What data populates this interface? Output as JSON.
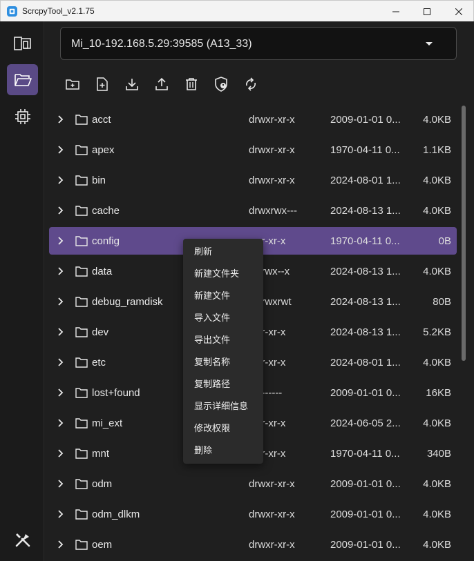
{
  "window": {
    "title": "ScrcpyTool_v2.1.75"
  },
  "colors": {
    "accent": "#5f4a8c",
    "sidebar_active": "#5a4a86",
    "background": "#1f1f1f"
  },
  "sidebar": {
    "items": [
      {
        "icon": "devices-icon",
        "active": false
      },
      {
        "icon": "folder-open-icon",
        "active": true
      },
      {
        "icon": "chip-icon",
        "active": false
      },
      {
        "icon": "tools-icon",
        "active": false
      }
    ]
  },
  "device_select": {
    "value": "Mi_10-192.168.5.29:39585 (A13_33)"
  },
  "toolbar": {
    "icons": [
      "new-folder-icon",
      "new-file-icon",
      "download-icon",
      "upload-icon",
      "delete-icon",
      "permission-icon",
      "refresh-icon"
    ]
  },
  "files": [
    {
      "name": "acct",
      "perm": "drwxr-xr-x",
      "date": "2009-01-01 0...",
      "size": "4.0KB"
    },
    {
      "name": "apex",
      "perm": "drwxr-xr-x",
      "date": "1970-04-11 0...",
      "size": "1.1KB"
    },
    {
      "name": "bin",
      "perm": "drwxr-xr-x",
      "date": "2024-08-01 1...",
      "size": "4.0KB"
    },
    {
      "name": "cache",
      "perm": "drwxrwx---",
      "date": "2024-08-13 1...",
      "size": "4.0KB"
    },
    {
      "name": "config",
      "perm": "wxr-xr-x",
      "date": "1970-04-11 0...",
      "size": "0B"
    },
    {
      "name": "data",
      "perm": "wxrwx--x",
      "date": "2024-08-13 1...",
      "size": "4.0KB"
    },
    {
      "name": "debug_ramdisk",
      "perm": "wxrwxrwt",
      "date": "2024-08-13 1...",
      "size": "80B"
    },
    {
      "name": "dev",
      "perm": "wxr-xr-x",
      "date": "2024-08-13 1...",
      "size": "5.2KB"
    },
    {
      "name": "etc",
      "perm": "wxr-xr-x",
      "date": "2024-08-01 1...",
      "size": "4.0KB"
    },
    {
      "name": "lost+found",
      "perm": "wx------",
      "date": "2009-01-01 0...",
      "size": "16KB"
    },
    {
      "name": "mi_ext",
      "perm": "wxr-xr-x",
      "date": "2024-06-05 2...",
      "size": "4.0KB"
    },
    {
      "name": "mnt",
      "perm": "wxr-xr-x",
      "date": "1970-04-11 0...",
      "size": "340B"
    },
    {
      "name": "odm",
      "perm": "drwxr-xr-x",
      "date": "2009-01-01 0...",
      "size": "4.0KB"
    },
    {
      "name": "odm_dlkm",
      "perm": "drwxr-xr-x",
      "date": "2009-01-01 0...",
      "size": "4.0KB"
    },
    {
      "name": "oem",
      "perm": "drwxr-xr-x",
      "date": "2009-01-01 0...",
      "size": "4.0KB"
    }
  ],
  "selected_index": 4,
  "context_menu": {
    "items": [
      "刷新",
      "新建文件夹",
      "新建文件",
      "导入文件",
      "导出文件",
      "复制名称",
      "复制路径",
      "显示详细信息",
      "修改权限",
      "删除"
    ]
  }
}
